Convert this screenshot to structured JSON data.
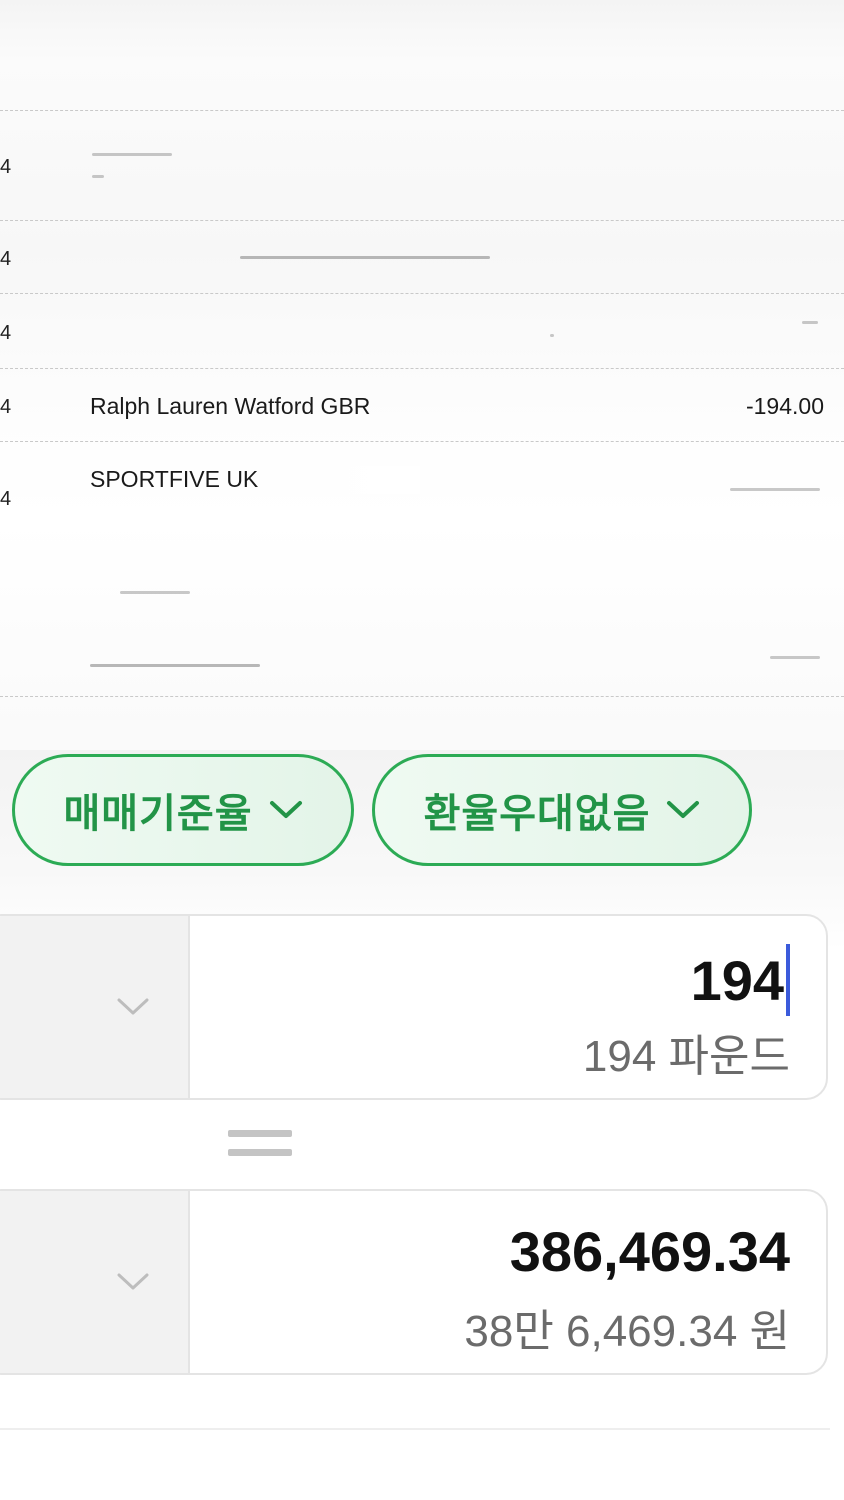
{
  "statement": {
    "rows": [
      {
        "num": "4",
        "desc": "",
        "amount": ""
      },
      {
        "num": "4",
        "desc": "",
        "amount": ""
      },
      {
        "num": "4",
        "desc": "",
        "amount": ""
      },
      {
        "num": "4",
        "desc": "Ralph Lauren Watford GBR",
        "amount": "-194.00"
      },
      {
        "num": "4",
        "desc": "SPORTFIVE UK",
        "amount": ""
      }
    ]
  },
  "converter": {
    "rate_type": "매매기준율",
    "discount": "환율우대없음",
    "from": {
      "value": "194",
      "formatted": "194 파운드"
    },
    "to": {
      "value": "386,469.34",
      "formatted": "38만 6,469.34 원"
    }
  },
  "colors": {
    "accent_green": "#2cab55",
    "caret_blue": "#3b5bdb"
  }
}
